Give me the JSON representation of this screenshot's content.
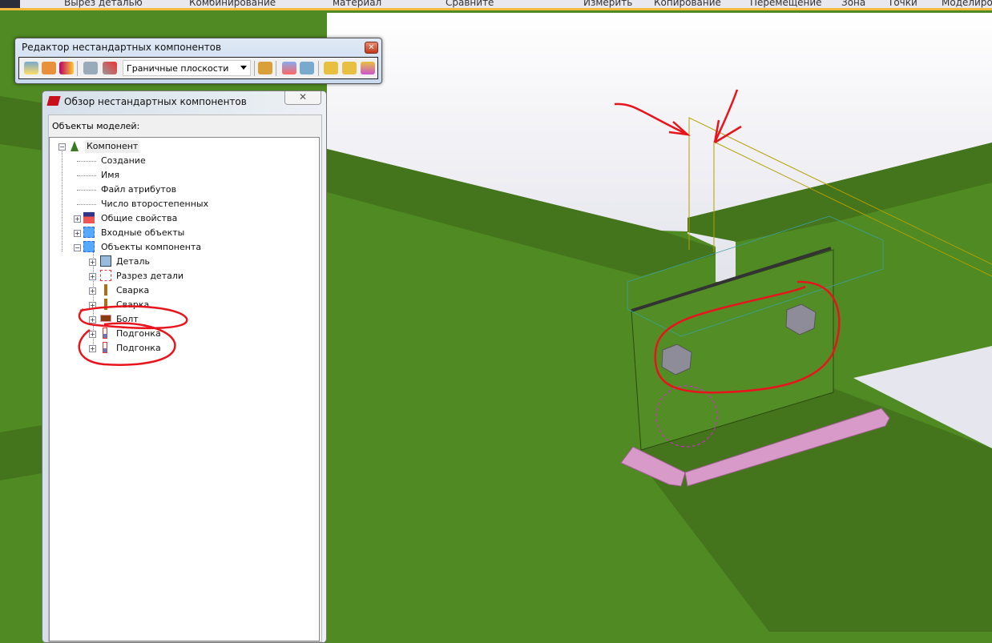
{
  "ribbon": {
    "items": [
      "Вырез деталью",
      "Комбинирование",
      "материал",
      "Сравните",
      "Измерить",
      "Копирование",
      "Перемещение",
      "Зона",
      "Точки",
      "Моделиро"
    ]
  },
  "editor": {
    "title": "Редактор нестандартных компонентов",
    "close": "✕",
    "combo_value": "Граничные плоскости"
  },
  "browser": {
    "title": "Обзор нестандартных компонентов",
    "close": "✕",
    "label": "Объекты моделей:",
    "tree": {
      "root": "Компонент",
      "creation": "Создание",
      "name": "Имя",
      "attr_file": "Файл атрибутов",
      "secondary_count": "Число второстепенных",
      "general": "Общие свойства",
      "inputs": "Входные объекты",
      "objects": "Объекты компонента",
      "children": [
        "Деталь",
        "Разрез детали",
        "Сварка",
        "Сварка",
        "Болт",
        "Подгонка",
        "Подгонка"
      ]
    }
  },
  "colors": {
    "annotation": "#e8141c",
    "beam": "#4f8a22",
    "beam_dark": "#44741b",
    "weld": "#d89ac8",
    "bolt": "#8e8c98"
  }
}
